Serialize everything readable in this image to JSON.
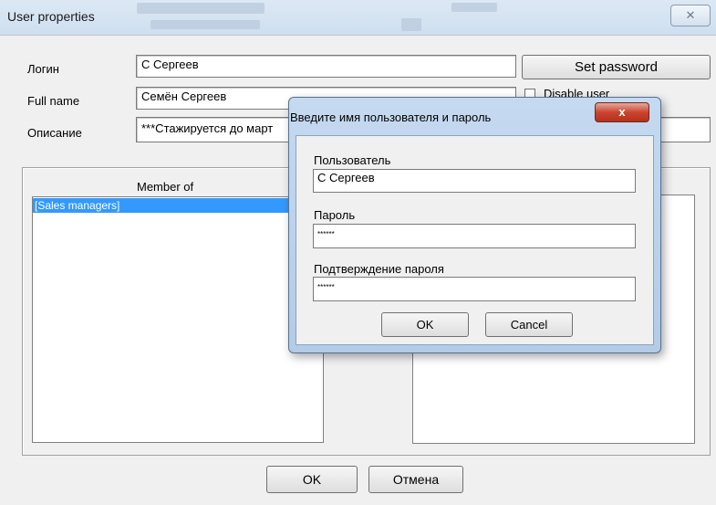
{
  "window": {
    "title": "User properties",
    "close_glyph": "✕"
  },
  "form": {
    "login_label": "Логин",
    "login_value": "С Сергеев",
    "fullname_label": "Full name",
    "fullname_value": "Семён Сергеев",
    "description_label": "Описание",
    "description_value": "***Стажируется до март"
  },
  "actions": {
    "set_password": "Set password",
    "disable_user": "Disable user"
  },
  "membership": {
    "header": "Member of",
    "items": [
      "[Sales managers]"
    ]
  },
  "footer": {
    "ok": "OK",
    "cancel": "Отмена"
  },
  "dialog": {
    "title": "Введите имя пользователя и пароль",
    "close_glyph": "x",
    "user_label": "Пользователь",
    "user_value": "С Сергеев",
    "password_label": "Пароль",
    "password_value": "******",
    "confirm_label": "Подтверждение пароля",
    "confirm_value": "******",
    "ok": "OK",
    "cancel": "Cancel"
  }
}
